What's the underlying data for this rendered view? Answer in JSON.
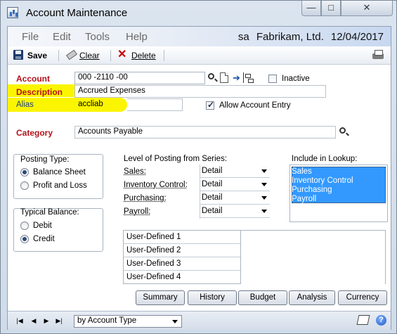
{
  "window": {
    "title": "Account Maintenance",
    "controls": {
      "minimize": "—",
      "maximize": "□",
      "close": "✕"
    }
  },
  "menu": {
    "items": [
      "File",
      "Edit",
      "Tools",
      "Help"
    ],
    "user": "sa",
    "company": "Fabrikam, Ltd.",
    "date": "12/04/2017"
  },
  "toolbar": {
    "save_label": "Save",
    "clear_label": "Clear",
    "delete_label": "Delete"
  },
  "form": {
    "account_label": "Account",
    "account_value": "000 -2110 -00",
    "inactive_label": "Inactive",
    "inactive_checked": false,
    "description_label": "Description",
    "description_value": "Accrued Expenses",
    "alias_label": "Alias",
    "alias_value": "accliab",
    "allow_entry_label": "Allow Account Entry",
    "allow_entry_checked": true,
    "category_label": "Category",
    "category_value": "Accounts Payable",
    "highlight_color": "#fbf500",
    "required_label_color": "#b5121b"
  },
  "posting_type": {
    "title": "Posting Type:",
    "options": [
      "Balance Sheet",
      "Profit and Loss"
    ],
    "selected": "Balance Sheet"
  },
  "typical_balance": {
    "title": "Typical Balance:",
    "options": [
      "Debit",
      "Credit"
    ],
    "selected": "Credit"
  },
  "level_of_posting": {
    "title": "Level of Posting from Series:",
    "rows": [
      {
        "label": "Sales:",
        "value": "Detail"
      },
      {
        "label": "Inventory Control:",
        "value": "Detail"
      },
      {
        "label": "Purchasing:",
        "value": "Detail"
      },
      {
        "label": "Payroll:",
        "value": "Detail"
      }
    ]
  },
  "lookup": {
    "title": "Include in Lookup:",
    "items": [
      "Sales",
      "Inventory Control",
      "Purchasing",
      "Payroll"
    ],
    "selection_color": "#3399ff"
  },
  "user_defined": {
    "rows": [
      {
        "label": "User-Defined 1",
        "value": ""
      },
      {
        "label": "User-Defined 2",
        "value": ""
      },
      {
        "label": "User-Defined 3",
        "value": ""
      },
      {
        "label": "User-Defined 4",
        "value": ""
      }
    ]
  },
  "buttons": {
    "summary": "Summary",
    "history": "History",
    "budget": "Budget",
    "analysis": "Analysis",
    "currency": "Currency"
  },
  "statusbar": {
    "nav": [
      "|◀",
      "◀",
      "▶",
      "▶|"
    ],
    "sort_value": "by Account Type",
    "help": "?"
  }
}
